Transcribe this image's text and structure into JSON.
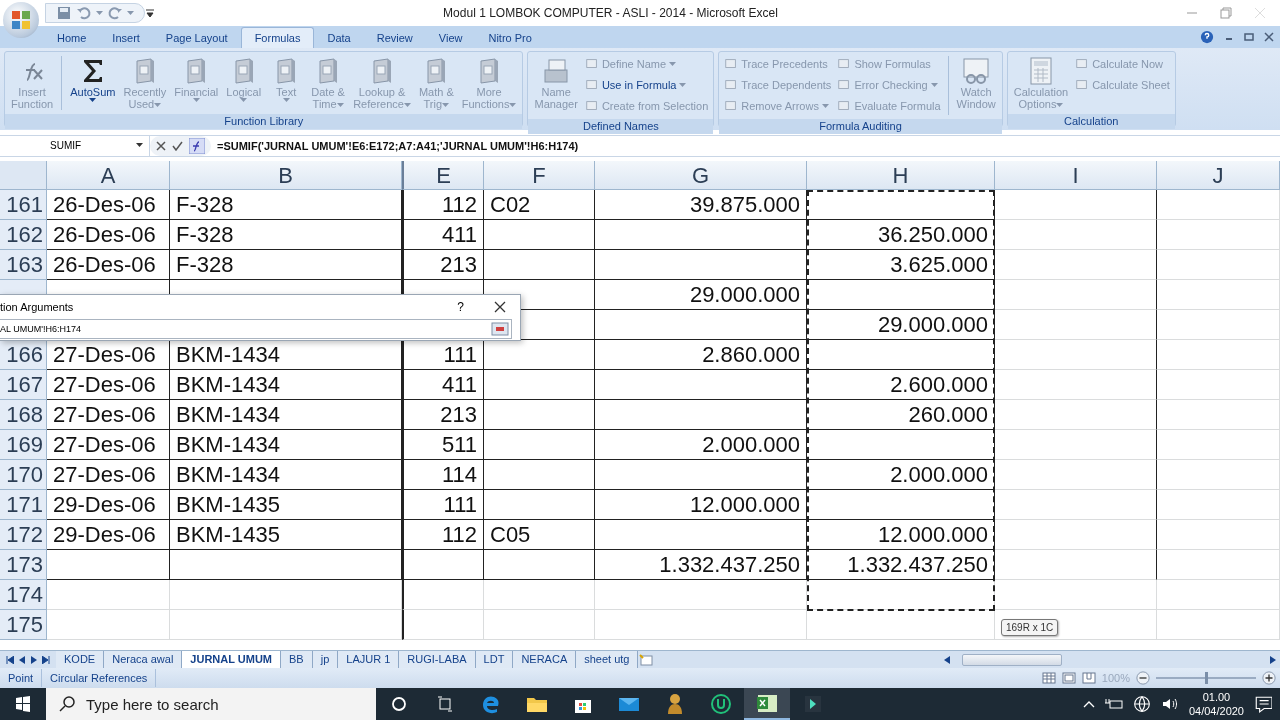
{
  "window": {
    "title": "Modul 1 LOMBOK COMPUTER - ASLI - 2014 - Microsoft Excel"
  },
  "ribbon_tabs": [
    {
      "label": "Home",
      "selected": false
    },
    {
      "label": "Insert",
      "selected": false
    },
    {
      "label": "Page Layout",
      "selected": false
    },
    {
      "label": "Formulas",
      "selected": true
    },
    {
      "label": "Data",
      "selected": false
    },
    {
      "label": "Review",
      "selected": false
    },
    {
      "label": "View",
      "selected": false
    },
    {
      "label": "Nitro Pro",
      "selected": false
    }
  ],
  "ribbon_groups": [
    {
      "label": "Function Library",
      "items": [
        {
          "kind": "large",
          "lines": [
            "Insert",
            "Function"
          ],
          "disabled": true,
          "dropdown": false
        },
        {
          "kind": "separator"
        },
        {
          "kind": "large",
          "lines": [
            "AutoSum"
          ],
          "disabled": false,
          "dropdown": true
        },
        {
          "kind": "large",
          "lines": [
            "Recently",
            "Used"
          ],
          "disabled": true,
          "dropdown": true
        },
        {
          "kind": "large",
          "lines": [
            "Financial"
          ],
          "disabled": true,
          "dropdown": true
        },
        {
          "kind": "large",
          "lines": [
            "Logical"
          ],
          "disabled": true,
          "dropdown": true
        },
        {
          "kind": "large",
          "lines": [
            "Text"
          ],
          "disabled": true,
          "dropdown": true
        },
        {
          "kind": "large",
          "lines": [
            "Date &",
            "Time"
          ],
          "disabled": true,
          "dropdown": true
        },
        {
          "kind": "large",
          "lines": [
            "Lookup &",
            "Reference"
          ],
          "disabled": true,
          "dropdown": true
        },
        {
          "kind": "large",
          "lines": [
            "Math &",
            "Trig"
          ],
          "disabled": true,
          "dropdown": true
        },
        {
          "kind": "large",
          "lines": [
            "More",
            "Functions"
          ],
          "disabled": true,
          "dropdown": true
        }
      ]
    },
    {
      "label": "Defined Names",
      "items": [
        {
          "kind": "large",
          "lines": [
            "Name",
            "Manager"
          ],
          "disabled": true,
          "dropdown": false
        },
        {
          "kind": "small",
          "label": "Define Name",
          "disabled": true,
          "dropdown": true
        },
        {
          "kind": "small",
          "label": "Use in Formula",
          "disabled": false,
          "dropdown": true
        },
        {
          "kind": "small",
          "label": "Create from Selection",
          "disabled": true,
          "dropdown": false
        }
      ]
    },
    {
      "label": "Formula Auditing",
      "items": [
        {
          "kind": "small",
          "label": "Trace Precedents",
          "disabled": true,
          "dropdown": false
        },
        {
          "kind": "small",
          "label": "Trace Dependents",
          "disabled": true,
          "dropdown": false
        },
        {
          "kind": "small",
          "label": "Remove Arrows",
          "disabled": true,
          "dropdown": true
        },
        {
          "kind": "small",
          "label": "Show Formulas",
          "disabled": true,
          "dropdown": false
        },
        {
          "kind": "small",
          "label": "Error Checking",
          "disabled": true,
          "dropdown": true
        },
        {
          "kind": "small",
          "label": "Evaluate Formula",
          "disabled": true,
          "dropdown": false
        },
        {
          "kind": "separator"
        },
        {
          "kind": "large",
          "lines": [
            "Watch",
            "Window"
          ],
          "disabled": true,
          "dropdown": false
        }
      ]
    },
    {
      "label": "Calculation",
      "items": [
        {
          "kind": "large",
          "lines": [
            "Calculation",
            "Options"
          ],
          "disabled": true,
          "dropdown": true
        },
        {
          "kind": "small",
          "label": "Calculate Now",
          "disabled": true,
          "dropdown": false
        },
        {
          "kind": "small",
          "label": "Calculate Sheet",
          "disabled": true,
          "dropdown": false
        }
      ]
    }
  ],
  "formula_bar": {
    "name_box": "SUMIF",
    "formula": "=SUMIF('JURNAL UMUM'!E6:E172;A7:A41;'JURNAL UMUM'!H6:H174)"
  },
  "columns": [
    "A",
    "B",
    "E",
    "F",
    "G",
    "H",
    "I",
    "J"
  ],
  "rows": [
    {
      "header": "161",
      "cells": {
        "a": "26-Des-06",
        "b": "F-328",
        "e": "112",
        "f": "C02",
        "g": "39.875.000"
      }
    },
    {
      "header": "162",
      "cells": {
        "a": "26-Des-06",
        "b": "F-328",
        "e": "411",
        "h": "36.250.000"
      }
    },
    {
      "header": "163",
      "cells": {
        "a": "26-Des-06",
        "b": "F-328",
        "e": "213",
        "h": "3.625.000"
      }
    },
    {
      "cells": {
        "g": "29.000.000"
      }
    },
    {
      "cells": {
        "h": "29.000.000"
      }
    },
    {
      "header": "166",
      "cells": {
        "a": "27-Des-06",
        "b": "BKM-1434",
        "e": "111",
        "g": "2.860.000"
      }
    },
    {
      "header": "167",
      "cells": {
        "a": "27-Des-06",
        "b": "BKM-1434",
        "e": "411",
        "h": "2.600.000"
      }
    },
    {
      "header": "168",
      "cells": {
        "a": "27-Des-06",
        "b": "BKM-1434",
        "e": "213",
        "h": "260.000"
      }
    },
    {
      "header": "169",
      "cells": {
        "a": "27-Des-06",
        "b": "BKM-1434",
        "e": "511",
        "g": "2.000.000"
      }
    },
    {
      "header": "170",
      "cells": {
        "a": "27-Des-06",
        "b": "BKM-1434",
        "e": "114",
        "h": "2.000.000"
      }
    },
    {
      "header": "171",
      "cells": {
        "a": "29-Des-06",
        "b": "BKM-1435",
        "e": "111",
        "g": "12.000.000"
      }
    },
    {
      "header": "172",
      "cells": {
        "a": "29-Des-06",
        "b": "BKM-1435",
        "e": "112",
        "f": "C05",
        "h": "12.000.000"
      }
    },
    {
      "header": "173",
      "cells": {
        "g": "1.332.437.250",
        "h": "1.332.437.250"
      }
    },
    {
      "header": "174",
      "cells": {}
    },
    {
      "header": "175",
      "cells": {}
    }
  ],
  "dialog": {
    "title": "tion Arguments",
    "help": "?",
    "value": "AL UMUM'!H6:H174"
  },
  "selection_tooltip": "169R x 1C",
  "sheet_tabs": [
    {
      "label": "KODE",
      "selected": false
    },
    {
      "label": "Neraca awal",
      "selected": false
    },
    {
      "label": "JURNAL UMUM",
      "selected": true
    },
    {
      "label": "BB",
      "selected": false
    },
    {
      "label": "jp",
      "selected": false
    },
    {
      "label": "LAJUR 1",
      "selected": false
    },
    {
      "label": "RUGI-LABA",
      "selected": false
    },
    {
      "label": "LDT",
      "selected": false
    },
    {
      "label": "NERACA",
      "selected": false
    },
    {
      "label": "sheet utg",
      "selected": false
    }
  ],
  "status_bar": {
    "mode": "Point",
    "items": [
      "Circular References"
    ],
    "zoom": {
      "reading": "100%",
      "level": 0.5
    }
  },
  "taskbar": {
    "search_placeholder": "Type here to search",
    "time": "01.00",
    "date": "04/04/2020"
  }
}
